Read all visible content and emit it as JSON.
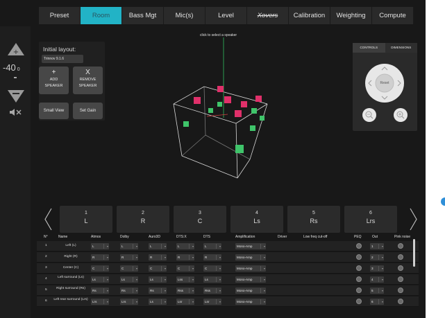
{
  "tabs": [
    {
      "label": "Preset",
      "active": false
    },
    {
      "label": "Room",
      "active": true
    },
    {
      "label": "Bass Mgt",
      "active": false
    },
    {
      "label": "Mic(s)",
      "active": false
    },
    {
      "label": "Level",
      "active": false
    },
    {
      "label": "Xovers",
      "active": false,
      "strike": true
    },
    {
      "label": "Calibration",
      "active": false
    },
    {
      "label": "Weighting",
      "active": false
    },
    {
      "label": "Compute",
      "active": false
    }
  ],
  "volume": {
    "value": "-40",
    "unit": "0",
    "icons": {
      "up": "triangle-up-icon",
      "down": "triangle-down-icon",
      "mute": "speaker-mute-icon"
    }
  },
  "layout_panel": {
    "title": "Initial layout:",
    "selected": "Trinnov 9.1.6",
    "add_symbol": "+",
    "add_line1": "ADD",
    "add_line2": "SPEAKER",
    "remove_symbol": "X",
    "remove_line1": "REMOVE",
    "remove_line2": "SPEAKER",
    "small_view": "Small View",
    "set_gain": "Set Gain"
  },
  "viewport": {
    "hint": "click to select a speaker",
    "colors": {
      "selected": "#e0306a",
      "speaker": "#3fc46a",
      "axis_y": "#30c060",
      "axis_x": "#d04040",
      "box": "#dddddd"
    }
  },
  "controls": {
    "tabs": [
      "CONTROLS",
      "DIMENSIONS"
    ],
    "active_tab": "CONTROLS",
    "reset": "Reset",
    "icons": [
      "pan-up-icon",
      "pan-down-icon",
      "pan-left-icon",
      "pan-right-icon",
      "zoom-out-icon",
      "zoom-in-icon"
    ]
  },
  "speakers": [
    {
      "num": "1",
      "code": "L"
    },
    {
      "num": "2",
      "code": "R"
    },
    {
      "num": "3",
      "code": "C"
    },
    {
      "num": "4",
      "code": "Ls"
    },
    {
      "num": "5",
      "code": "Rs"
    },
    {
      "num": "6",
      "code": "Lrs"
    }
  ],
  "table": {
    "headers": [
      "N°",
      "Name",
      "Atmos",
      "Dolby",
      "Auro3D",
      "DTS:X",
      "DTS",
      "Amplification",
      "Driver",
      "Low freq cut-off",
      "PEQ",
      "Out",
      "Pink noise"
    ],
    "rows": [
      {
        "n": "1",
        "name": "Left (L)",
        "atmos": "L",
        "dolby": "L",
        "auro": "L",
        "dtsx": "L",
        "dts": "L",
        "amp": "Mono-Amp",
        "out": "1"
      },
      {
        "n": "2",
        "name": "Right (R)",
        "atmos": "R",
        "dolby": "R",
        "auro": "R",
        "dtsx": "R",
        "dts": "R",
        "amp": "Mono-Amp",
        "out": "2"
      },
      {
        "n": "3",
        "name": "Center (C)",
        "atmos": "C",
        "dolby": "C",
        "auro": "C",
        "dtsx": "C",
        "dts": "C",
        "amp": "Mono-Amp",
        "out": "3"
      },
      {
        "n": "4",
        "name": "Left surround (Ls)",
        "atmos": "Ls",
        "dolby": "Ls",
        "auro": "Ls",
        "dtsx": "Lss",
        "dts": "Ls",
        "amp": "Mono-Amp",
        "out": "4"
      },
      {
        "n": "5",
        "name": "Right surround (Rs)",
        "atmos": "Rs",
        "dolby": "Rs",
        "auro": "Rs",
        "dtsx": "Rss",
        "dts": "Rss",
        "amp": "Mono-Amp",
        "out": "5"
      },
      {
        "n": "6",
        "name": "Left rear surround (Lrs)",
        "atmos": "Lrs",
        "dolby": "Lrs",
        "auro": "Ls",
        "dtsx": "Lsr",
        "dts": "Lsr",
        "amp": "Mono-Amp",
        "out": "6"
      }
    ]
  }
}
